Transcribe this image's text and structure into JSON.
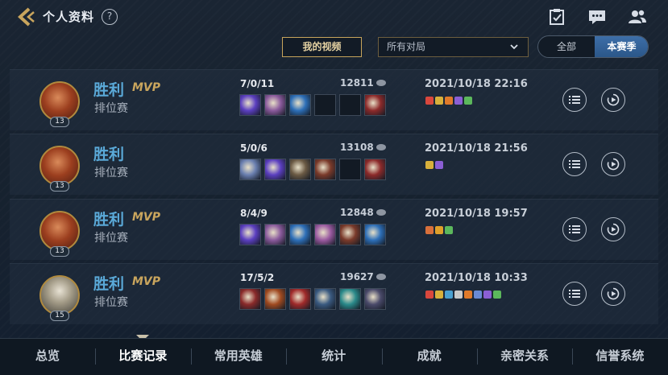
{
  "header": {
    "title": "个人资料",
    "help_label": "?"
  },
  "filters": {
    "video_button": "我的视频",
    "match_filter": "所有对局",
    "segment_all": "全部",
    "segment_season": "本赛季"
  },
  "matches": [
    {
      "result": "胜利",
      "mvp": "MVP",
      "mode": "排位赛",
      "level": "13",
      "kda": "7/0/11",
      "gold": "12811",
      "date": "2021/10/18 22:16",
      "items": [
        "#5b3fc0",
        "#8a5a9c",
        "#2d6fb8",
        "",
        "",
        "#8c2a2a"
      ],
      "badges": [
        "#d9473d",
        "#d8b03b",
        "#e07a2a",
        "#8b5fd4",
        "#5cb85c"
      ]
    },
    {
      "result": "胜利",
      "mvp": "",
      "mode": "排位赛",
      "level": "13",
      "kda": "5/0/6",
      "gold": "13108",
      "date": "2021/10/18 21:56",
      "items": [
        "#6a7fb0",
        "#5b3fc0",
        "#6b5a44",
        "#7a3a2a",
        "",
        "#8c2a2a"
      ],
      "badges": [
        "#d8b03b",
        "#8b5fd4"
      ]
    },
    {
      "result": "胜利",
      "mvp": "MVP",
      "mode": "排位赛",
      "level": "13",
      "kda": "8/4/9",
      "gold": "12848",
      "date": "2021/10/18 19:57",
      "items": [
        "#5b3fc0",
        "#8a5a9c",
        "#2d6fb8",
        "#9a5aa0",
        "#7a3a2a",
        "#2d6fb8"
      ],
      "badges": [
        "#d8703b",
        "#e0a02a",
        "#5cb85c"
      ]
    },
    {
      "result": "胜利",
      "mvp": "MVP",
      "mode": "排位赛",
      "level": "15",
      "kda": "17/5/2",
      "gold": "19627",
      "date": "2021/10/18 10:33",
      "items": [
        "#8a2a2a",
        "#a04a20",
        "#a02a2a",
        "#3a5a80",
        "#2a8a8a",
        "#4a4a6a"
      ],
      "badges": [
        "#d9473d",
        "#d8b03b",
        "#4aa0d0",
        "#c9c9c9",
        "#e07a2a",
        "#6a8ad4",
        "#8b5fd4",
        "#5cb85c"
      ]
    }
  ],
  "tabs": [
    "总览",
    "比赛记录",
    "常用英雄",
    "统计",
    "成就",
    "亲密关系",
    "信誉系统"
  ],
  "active_tab": "比赛记录",
  "colors": {
    "accent_gold": "#c9a55d",
    "win_blue": "#5aa9d8",
    "active_segment": "#3d6ea8"
  }
}
